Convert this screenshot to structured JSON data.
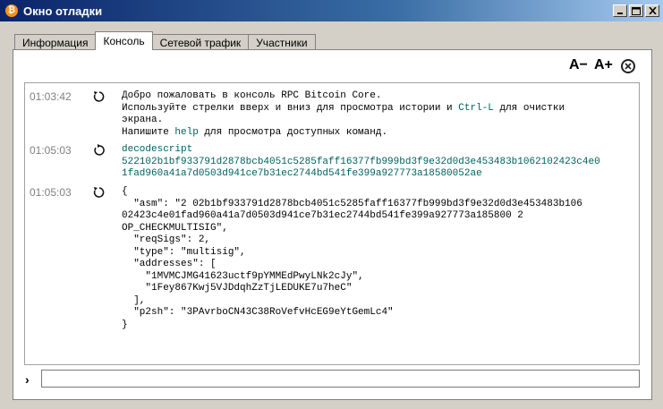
{
  "window": {
    "title": "Окно отладки",
    "minimize": "_",
    "maximize": "□",
    "close": "×"
  },
  "tabs": [
    {
      "label": "Информация",
      "active": false
    },
    {
      "label": "Консоль",
      "active": true
    },
    {
      "label": "Сетевой трафик",
      "active": false
    },
    {
      "label": "Участники",
      "active": false
    }
  ],
  "toolbar": {
    "font_smaller": "A−",
    "font_bigger": "A+"
  },
  "console": {
    "messages": [
      {
        "time": "01:03:42",
        "icon": "reply-icon",
        "lines": [
          "Добро пожаловать в консоль RPC Bitcoin Core.",
          "Используйте стрелки вверх и вниз для просмотра истории и Ctrl-L для очистки",
          "экрана.",
          "Напишите help для просмотра доступных команд."
        ]
      },
      {
        "time": "01:05:03",
        "icon": "command-icon",
        "lines": [
          "decodescript",
          "522102b1bf933791d2878bcb4051c5285faff16377fb999bd3f9e32d0d3e453483b1062102423c4e0",
          "1fad960a41a7d0503d941ce7b31ec2744bd541fe399a927773a18580052ae"
        ]
      },
      {
        "time": "01:05:03",
        "icon": "reply-icon",
        "lines": [
          "{",
          "  \"asm\": \"2 02b1bf933791d2878bcb4051c5285faff16377fb999bd3f9e32d0d3e453483b106",
          "02423c4e01fad960a41a7d0503d941ce7b31ec2744bd541fe399a927773a185800 2",
          "OP_CHECKMULTISIG\",",
          "  \"reqSigs\": 2,",
          "  \"type\": \"multisig\",",
          "  \"addresses\": [",
          "    \"1MVMCJMG41623uctf9pYMMEdPwyLNk2cJy\",",
          "    \"1Fey867Kwj5VJDdqhZzTjLEDUKE7u7heC\"",
          "  ],",
          "  \"p2sh\": \"3PAvrboCN43C38RoVefvHcEG9eYtGemLc4\"",
          "}"
        ]
      }
    ]
  },
  "input": {
    "prompt": "›",
    "value": ""
  }
}
